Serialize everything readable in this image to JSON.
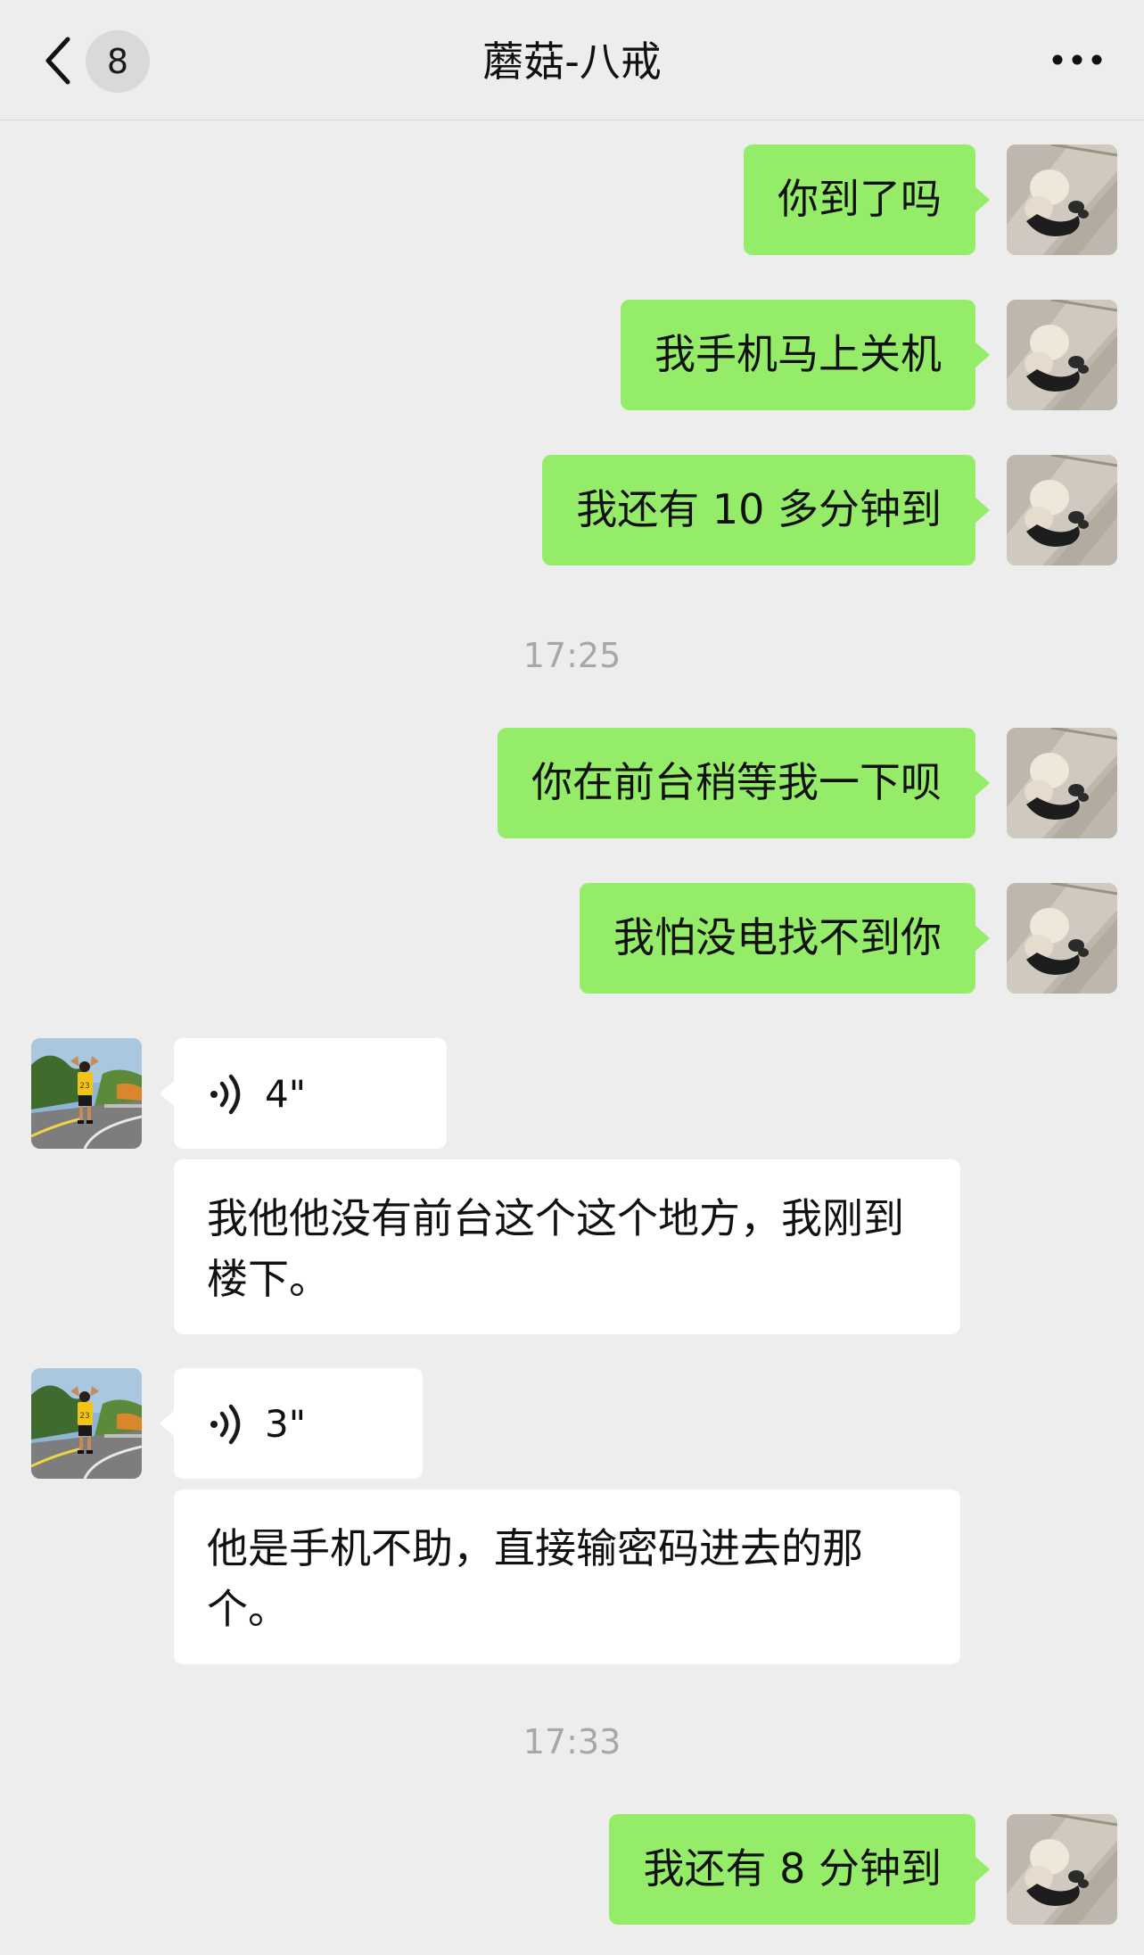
{
  "header": {
    "unread_count": "8",
    "title": "蘑菇-八戒",
    "back_icon": "chevron-left-icon",
    "more_icon": "more-dots-icon"
  },
  "messages": [
    {
      "type": "sent",
      "text": "你到了吗"
    },
    {
      "type": "sent",
      "text": "我手机马上关机"
    },
    {
      "type": "sent",
      "text": "我还有 10 多分钟到"
    },
    {
      "type": "time",
      "text": "17:25"
    },
    {
      "type": "sent",
      "text": "你在前台稍等我一下呗"
    },
    {
      "type": "sent",
      "text": "我怕没电找不到你"
    },
    {
      "type": "voice",
      "duration": "4\"",
      "transcript": "我他他没有前台这个这个地方，我刚到楼下。"
    },
    {
      "type": "voice",
      "duration": "3\"",
      "transcript": "他是手机不助，直接输密码进去的那个。"
    },
    {
      "type": "time",
      "text": "17:33"
    },
    {
      "type": "sent",
      "text": "我还有 8 分钟到"
    }
  ],
  "colors": {
    "background": "#ededed",
    "sent_bubble": "#95ec69",
    "received_bubble": "#ffffff",
    "timestamp": "#a7a7a7"
  }
}
